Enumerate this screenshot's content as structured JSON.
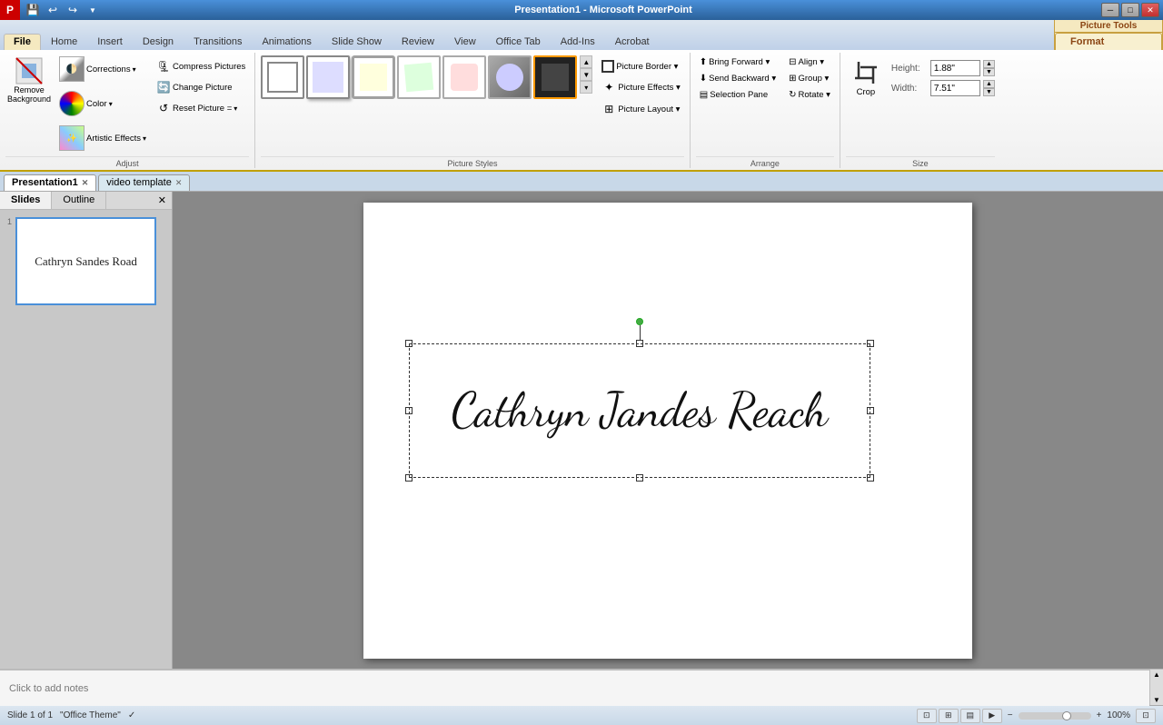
{
  "titlebar": {
    "title": "Presentation1 - Microsoft PowerPoint",
    "min_label": "─",
    "max_label": "□",
    "close_label": "✕"
  },
  "quickaccess": {
    "save": "💾",
    "undo": "↩",
    "redo": "↪",
    "dropdown": "▼"
  },
  "ribbontabs": {
    "picture_tools": "Picture Tools",
    "format": "Format",
    "tabs": [
      "File",
      "Home",
      "Insert",
      "Design",
      "Transitions",
      "Animations",
      "Slide Show",
      "Review",
      "View",
      "Office Tab",
      "Add-Ins",
      "Acrobat"
    ]
  },
  "adjust_group": {
    "label": "Adjust",
    "remove_bg": "Remove\nBackground",
    "corrections": "Corrections",
    "color": "Color",
    "artistic_effects": "Artistic\nEffects",
    "compress": "Compress Pictures",
    "change": "Change Picture",
    "reset": "Reset Picture ="
  },
  "picture_styles": {
    "label": "Picture Styles",
    "items": [
      "simple",
      "shadow",
      "rounded",
      "oval",
      "beveled",
      "metal",
      "dark"
    ]
  },
  "picture_border": {
    "label": "Picture Border ▾"
  },
  "picture_effects": {
    "label": "Picture Effects ▾"
  },
  "picture_layout": {
    "label": "Picture Layout ▾"
  },
  "arrange_group": {
    "label": "Arrange",
    "bring_forward": "Bring Forward ▾",
    "send_backward": "Send Backward ▾",
    "selection_pane": "Selection Pane",
    "align": "Align ▾",
    "group": "Group ▾",
    "rotate": "Rotate ▾"
  },
  "size_group": {
    "label": "Size",
    "crop": "Crop",
    "height_label": "Height:",
    "height_value": "1.88\"",
    "width_label": "Width:",
    "width_value": "7.51\""
  },
  "doc_tabs": [
    {
      "name": "Presentation1",
      "active": true
    },
    {
      "name": "video template",
      "active": false
    }
  ],
  "slide_panel": {
    "slides_tab": "Slides",
    "outline_tab": "Outline",
    "slide_number": "1",
    "sig_text": "Cathryn Sandes Road"
  },
  "canvas": {
    "notes_placeholder": "Click to add notes",
    "sig_text": "Cathryn Jandes Reach"
  },
  "statusbar": {
    "slide_info": "Slide 1 of 1",
    "theme": "\"Office Theme\"",
    "check_icon": "✓",
    "zoom": "100%"
  }
}
